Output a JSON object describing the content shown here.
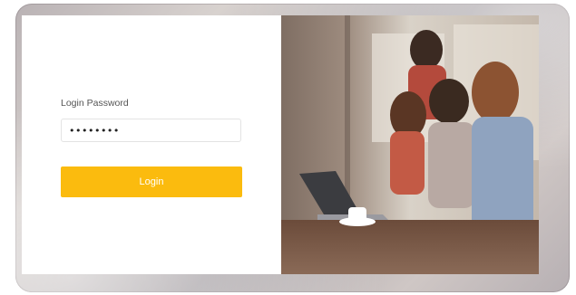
{
  "login": {
    "password_label": "Login Password",
    "password_value": "••••••••",
    "login_button_label": "Login"
  },
  "photo": {
    "subject": "team-working-at-laptop"
  },
  "colors": {
    "accent": "#fbbb0e",
    "panel_bg": "#ffffff",
    "frame": "#c4bcbd"
  }
}
